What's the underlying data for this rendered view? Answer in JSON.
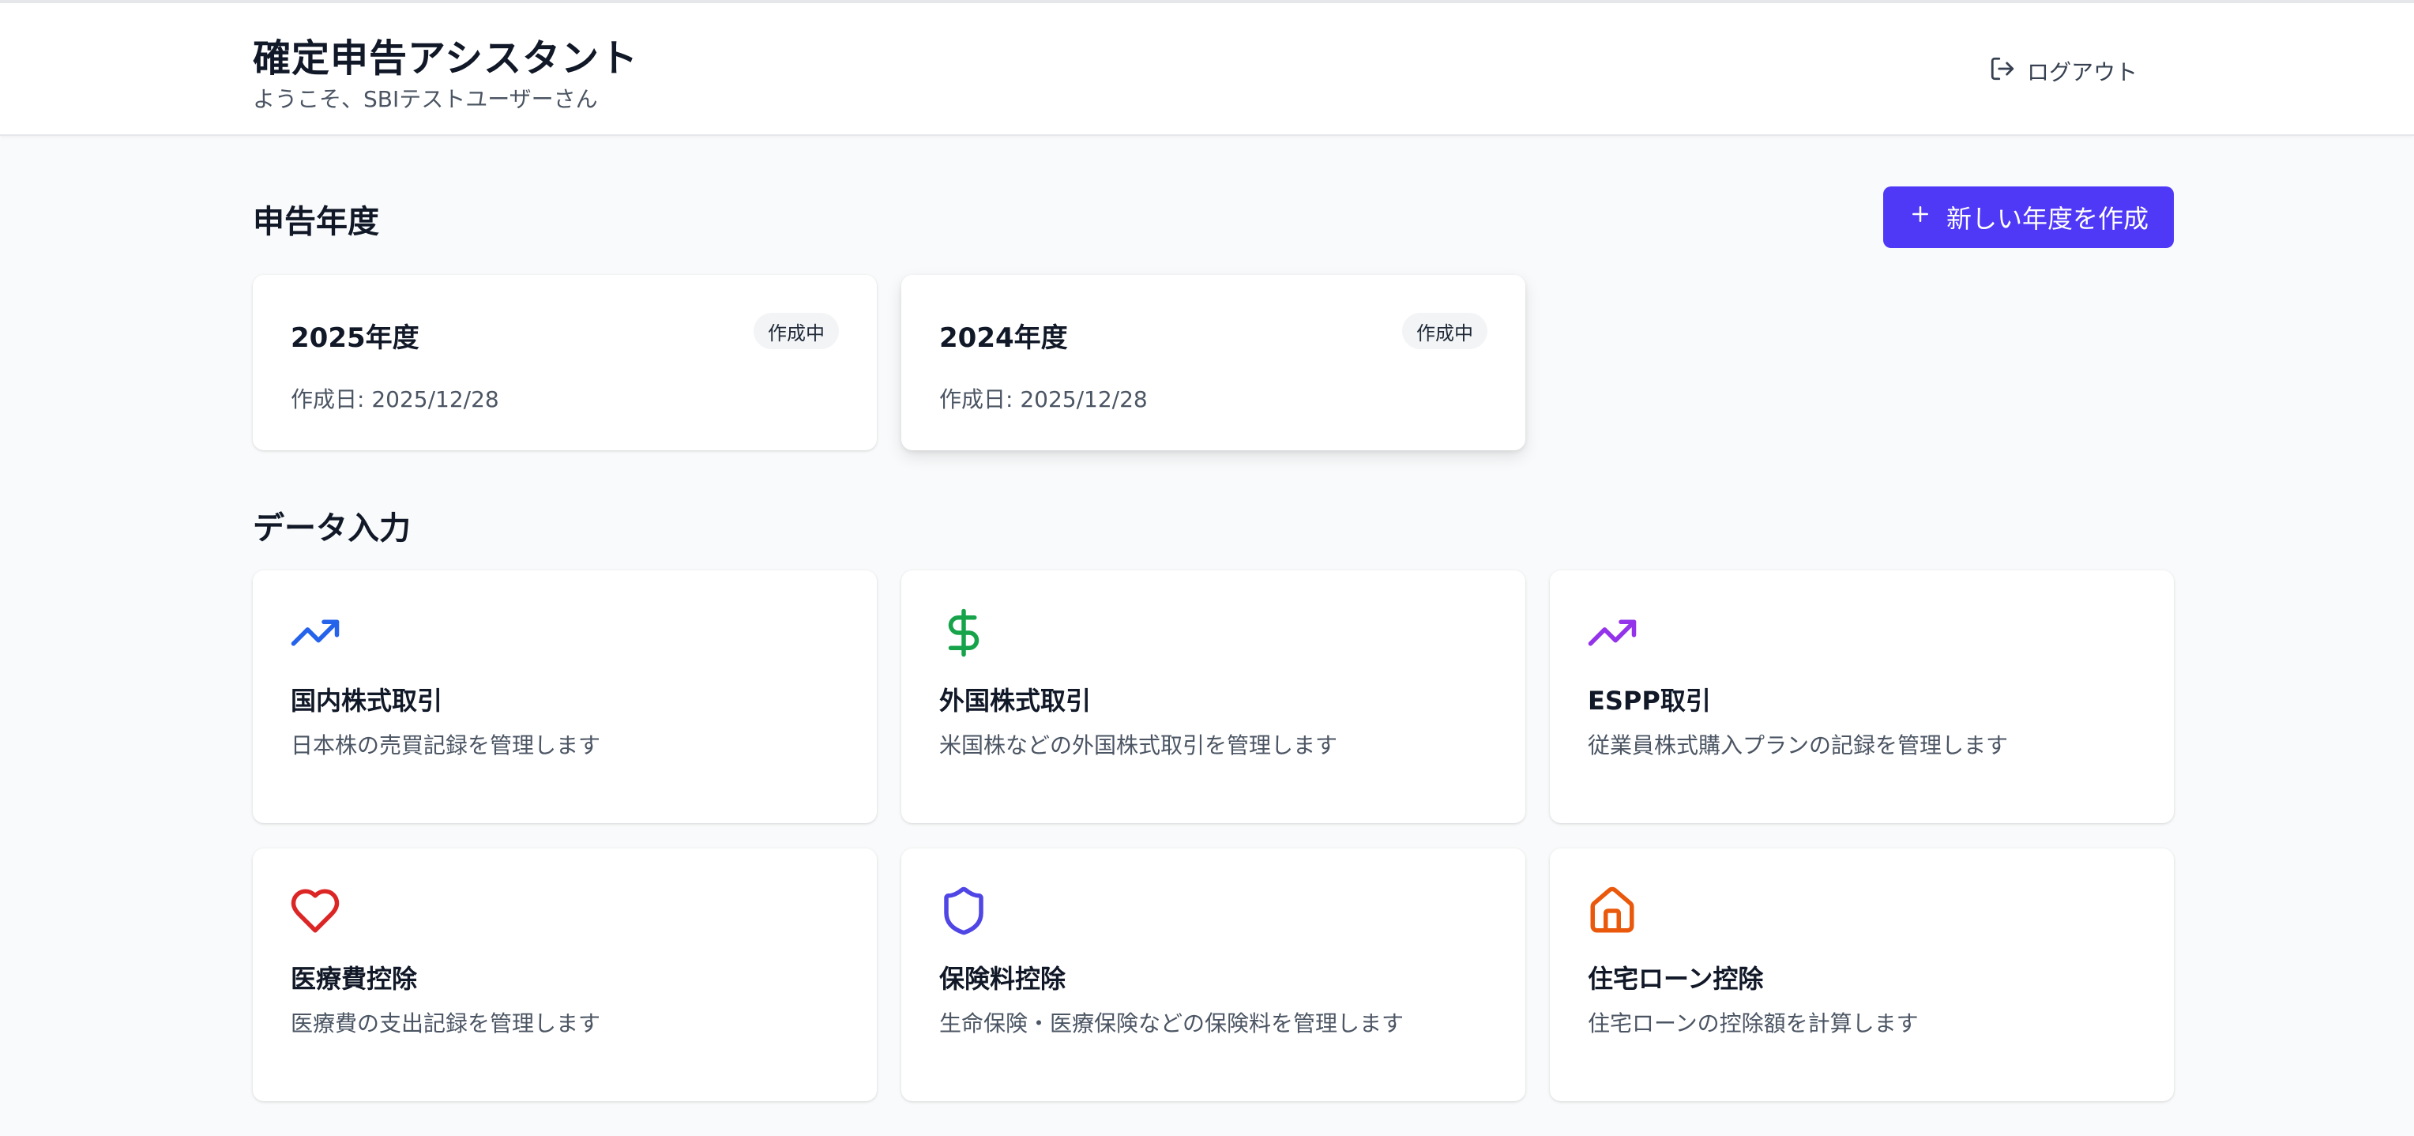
{
  "header": {
    "title": "確定申告アシスタント",
    "subtitle": "ようこそ、SBIテストユーザーさん",
    "logout_label": "ログアウト"
  },
  "years_section": {
    "title": "申告年度",
    "new_button_label": "新しい年度を作成",
    "years": [
      {
        "title": "2025年度",
        "status": "作成中",
        "created": "作成日: 2025/12/28"
      },
      {
        "title": "2024年度",
        "status": "作成中",
        "created": "作成日: 2025/12/28"
      }
    ]
  },
  "data_section": {
    "title": "データ入力",
    "items": [
      {
        "icon": "trending-up-icon",
        "color": "#2563eb",
        "title": "国内株式取引",
        "description": "日本株の売買記録を管理します"
      },
      {
        "icon": "dollar-sign-icon",
        "color": "#16a34a",
        "title": "外国株式取引",
        "description": "米国株などの外国株式取引を管理します"
      },
      {
        "icon": "trending-up-icon",
        "color": "#9333ea",
        "title": "ESPP取引",
        "description": "従業員株式購入プランの記録を管理します"
      },
      {
        "icon": "heart-icon",
        "color": "#dc2626",
        "title": "医療費控除",
        "description": "医療費の支出記録を管理します"
      },
      {
        "icon": "shield-icon",
        "color": "#4f46e5",
        "title": "保険料控除",
        "description": "生命保険・医療保険などの保険料を管理します"
      },
      {
        "icon": "home-icon",
        "color": "#ea580c",
        "title": "住宅ローン控除",
        "description": "住宅ローンの控除額を計算します"
      }
    ]
  },
  "colors": {
    "accent": "#4f39f6",
    "background": "#f9fafb"
  }
}
